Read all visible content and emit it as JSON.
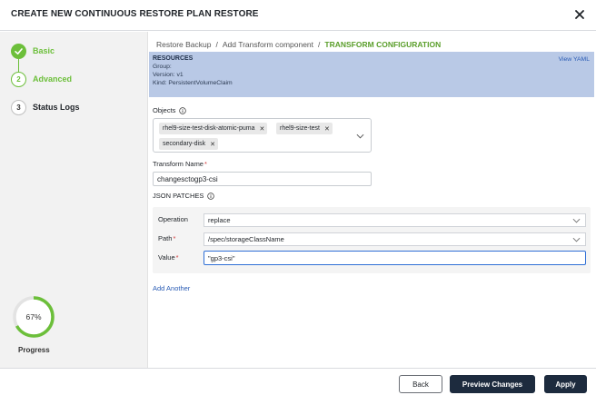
{
  "header": {
    "title": "CREATE NEW CONTINUOUS RESTORE PLAN RESTORE"
  },
  "steps": [
    {
      "number": "1",
      "label": "Basic",
      "state": "done"
    },
    {
      "number": "2",
      "label": "Advanced",
      "state": "active"
    },
    {
      "number": "3",
      "label": "Status Logs",
      "state": "pending"
    }
  ],
  "progress": {
    "value": 0.67,
    "value_text": "67%",
    "label": "Progress"
  },
  "breadcrumb": {
    "items": [
      "Restore Backup",
      "Add Transform component"
    ],
    "separator": "/",
    "current": "TRANSFORM CONFIGURATION"
  },
  "resources": {
    "title": "RESOURCES",
    "group": "Group:",
    "version": "Version: v1",
    "kind": "Kind: PersistentVolumeClaim",
    "view_yaml": "View YAML"
  },
  "objects": {
    "label": "Objects",
    "chips": [
      "rhel9-size-test-disk-atomic-puma",
      "rhel9-size-test",
      "secondary-disk"
    ]
  },
  "transform_name": {
    "label": "Transform Name",
    "value": "changesctogp3-csi"
  },
  "json_patches": {
    "label": "JSON PATCHES",
    "operation": {
      "label": "Operation",
      "value": "replace"
    },
    "path": {
      "label": "Path",
      "value": "/spec/storageClassName"
    },
    "value": {
      "label": "Value",
      "value": "\"gp3-csi\""
    }
  },
  "add_another": "Add Another",
  "footer": {
    "back": "Back",
    "preview": "Preview Changes",
    "apply": "Apply"
  },
  "colors": {
    "accent_green": "#6cbf3a",
    "primary_dark": "#1d2b3e",
    "link_blue": "#2a5cb5",
    "resources_bg": "#b9c9e6"
  }
}
